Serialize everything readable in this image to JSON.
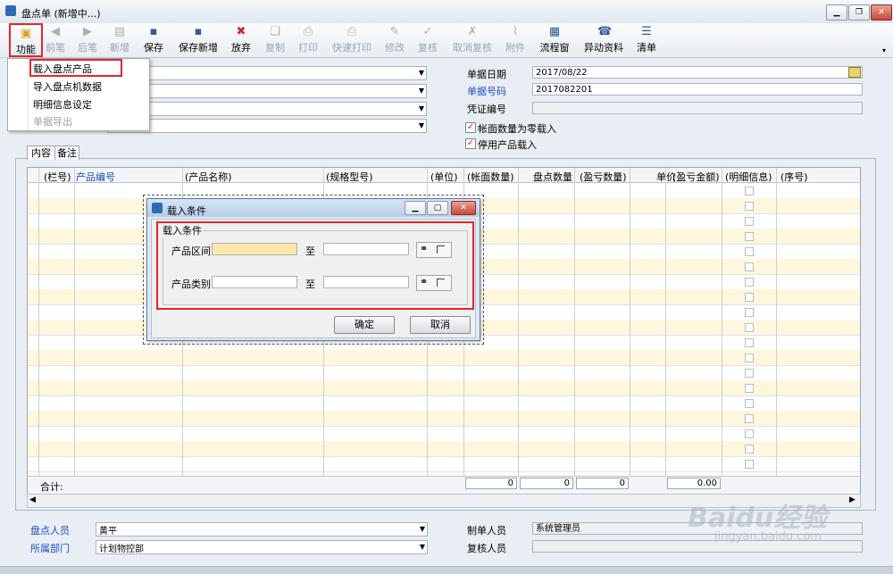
{
  "window": {
    "title": "盘点单 (新增中...)"
  },
  "toolbar": {
    "function": "功能",
    "prev": "前笔",
    "next": "后笔",
    "new": "新增",
    "save": "保存",
    "save_new": "保存新增",
    "discard": "放弃",
    "copy": "复制",
    "print": "打印",
    "quick_print": "快速打印",
    "modify": "修改",
    "review": "复核",
    "cancel_review": "取消复核",
    "attachment": "附件",
    "flow": "流程窗",
    "change_info": "异动资料",
    "list": "清单"
  },
  "menu": {
    "items": [
      "载入盘点产品",
      "导入盘点机数据",
      "明细信息设定",
      "单据导出"
    ]
  },
  "header": {
    "date_label": "单据日期",
    "date_value": "2017/08/22",
    "docno_label": "单据号码",
    "docno_value": "2017082201",
    "voucher_label": "凭证编号",
    "cb1_label": "帐面数量为零载入",
    "cb2_label": "停用产品载入"
  },
  "tabs": [
    "内容",
    "备注"
  ],
  "grid": {
    "columns": [
      "(栏号)",
      "产品编号",
      "(产品名称)",
      "(规格型号)",
      "(单位)",
      "(帐面数量)",
      "盘点数量",
      "(盈亏数量)",
      "单价",
      "(盈亏金额)",
      "(明细信息)",
      "(序号)"
    ],
    "total_label": "合计:",
    "totals": [
      "0",
      "0",
      "0",
      "0.00"
    ]
  },
  "dialog": {
    "title": "载入条件",
    "group": "载入条件",
    "range_label": "产品区间",
    "type_label": "产品类别",
    "to": "至",
    "ok": "确定",
    "cancel": "取消"
  },
  "footer": {
    "counter_label": "盘点人员",
    "counter_value": "黄平",
    "dept_label": "所属部门",
    "dept_value": "计划物控部",
    "maker_label": "制单人员",
    "maker_value": "系统管理员",
    "reviewer_label": "复核人员"
  },
  "watermark": {
    "logo": "Baidu经验",
    "url": "jingyan.baidu.com"
  },
  "colors": {
    "highlight": "#e0272c",
    "row_alt": "#fff7dd",
    "link_blue": "#1f4fc0"
  }
}
